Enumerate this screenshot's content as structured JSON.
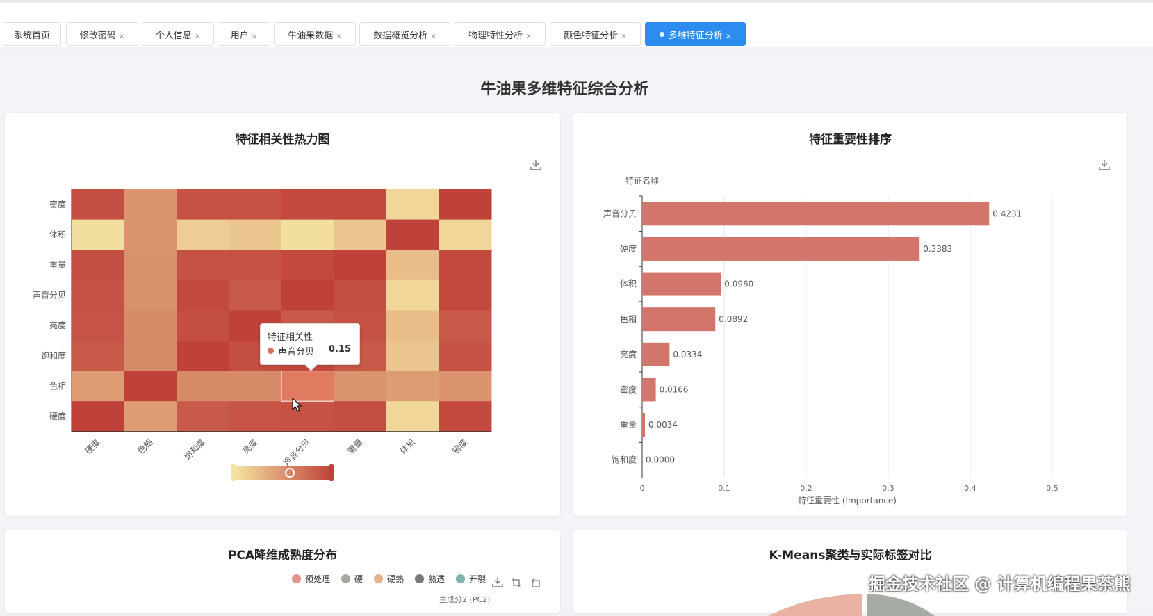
{
  "tabs": [
    {
      "label": "系统首页",
      "closable": false
    },
    {
      "label": "修改密码",
      "closable": true
    },
    {
      "label": "个人信息",
      "closable": true
    },
    {
      "label": "用户",
      "closable": true
    },
    {
      "label": "牛油果数据",
      "closable": true
    },
    {
      "label": "数据概览分析",
      "closable": true
    },
    {
      "label": "物理特性分析",
      "closable": true
    },
    {
      "label": "颜色特征分析",
      "closable": true
    },
    {
      "label": "多维特征分析",
      "closable": true,
      "active": true
    }
  ],
  "close_glyph": "×",
  "page_title": "牛油果多维特征综合分析",
  "heatmap_card": {
    "title": "特征相关性热力图",
    "tooltip": {
      "title": "特征相关性",
      "series": "声音分贝",
      "value": "0.15"
    }
  },
  "importance_card": {
    "title": "特征重要性排序"
  },
  "pca_card": {
    "title": "PCA降维成熟度分布",
    "y_axis_label": "主成分2 (PC2)",
    "legend": [
      {
        "name": "预处理",
        "color": "#e2958a"
      },
      {
        "name": "硬",
        "color": "#a3a8a0"
      },
      {
        "name": "硬熟",
        "color": "#e4b48a"
      },
      {
        "name": "熟透",
        "color": "#7a7a7a"
      },
      {
        "name": "开裂",
        "color": "#7fb1ae"
      }
    ]
  },
  "kmeans_card": {
    "title": "K-Means聚类与实际标签对比"
  },
  "watermark": "掘金技术社区 @ 计算机编程果茶熊",
  "chart_data": [
    {
      "type": "heatmap",
      "title": "特征相关性热力图",
      "x_categories": [
        "硬度",
        "色相",
        "饱和度",
        "亮度",
        "声音分贝",
        "重量",
        "体积",
        "密度"
      ],
      "y_categories": [
        "硬度",
        "色相",
        "饱和度",
        "亮度",
        "声音分贝",
        "重量",
        "体积",
        "密度"
      ],
      "values": [
        [
          1.0,
          0.45,
          0.85,
          0.88,
          0.9,
          0.92,
          0.1,
          0.95
        ],
        [
          0.45,
          1.0,
          0.55,
          0.55,
          0.15,
          0.5,
          0.45,
          0.5
        ],
        [
          0.85,
          0.55,
          1.0,
          0.92,
          0.95,
          0.85,
          0.2,
          0.9
        ],
        [
          0.88,
          0.55,
          0.92,
          1.0,
          0.85,
          0.9,
          0.25,
          0.85
        ],
        [
          0.9,
          0.52,
          0.95,
          0.85,
          1.0,
          0.92,
          0.1,
          0.95
        ],
        [
          0.92,
          0.52,
          0.9,
          0.9,
          0.95,
          1.0,
          0.25,
          0.95
        ],
        [
          0.05,
          0.5,
          0.15,
          0.2,
          0.05,
          0.2,
          1.0,
          0.1
        ],
        [
          0.92,
          0.5,
          0.9,
          0.9,
          0.95,
          0.95,
          0.1,
          1.0
        ]
      ],
      "visual_map_range": [
        0,
        1
      ],
      "colors": [
        "#f5e6a3",
        "#c0413a"
      ]
    },
    {
      "type": "bar",
      "orientation": "horizontal",
      "title": "特征重要性排序",
      "ylabel": "特征名称",
      "xlabel": "特征重要性 (Importance)",
      "categories": [
        "声音分贝",
        "硬度",
        "体积",
        "色相",
        "亮度",
        "密度",
        "重量",
        "饱和度"
      ],
      "values": [
        0.4231,
        0.3383,
        0.096,
        0.0892,
        0.0334,
        0.0166,
        0.0034,
        0.0
      ],
      "value_labels": [
        "0.4231",
        "0.3383",
        "0.0960",
        "0.0892",
        "0.0334",
        "0.0166",
        "0.0034",
        "0.0000"
      ],
      "xlim": [
        0,
        0.5
      ],
      "xticks": [
        "0",
        "0.1",
        "0.2",
        "0.3",
        "0.4",
        "0.5"
      ],
      "bar_color": "#d2756b"
    }
  ]
}
